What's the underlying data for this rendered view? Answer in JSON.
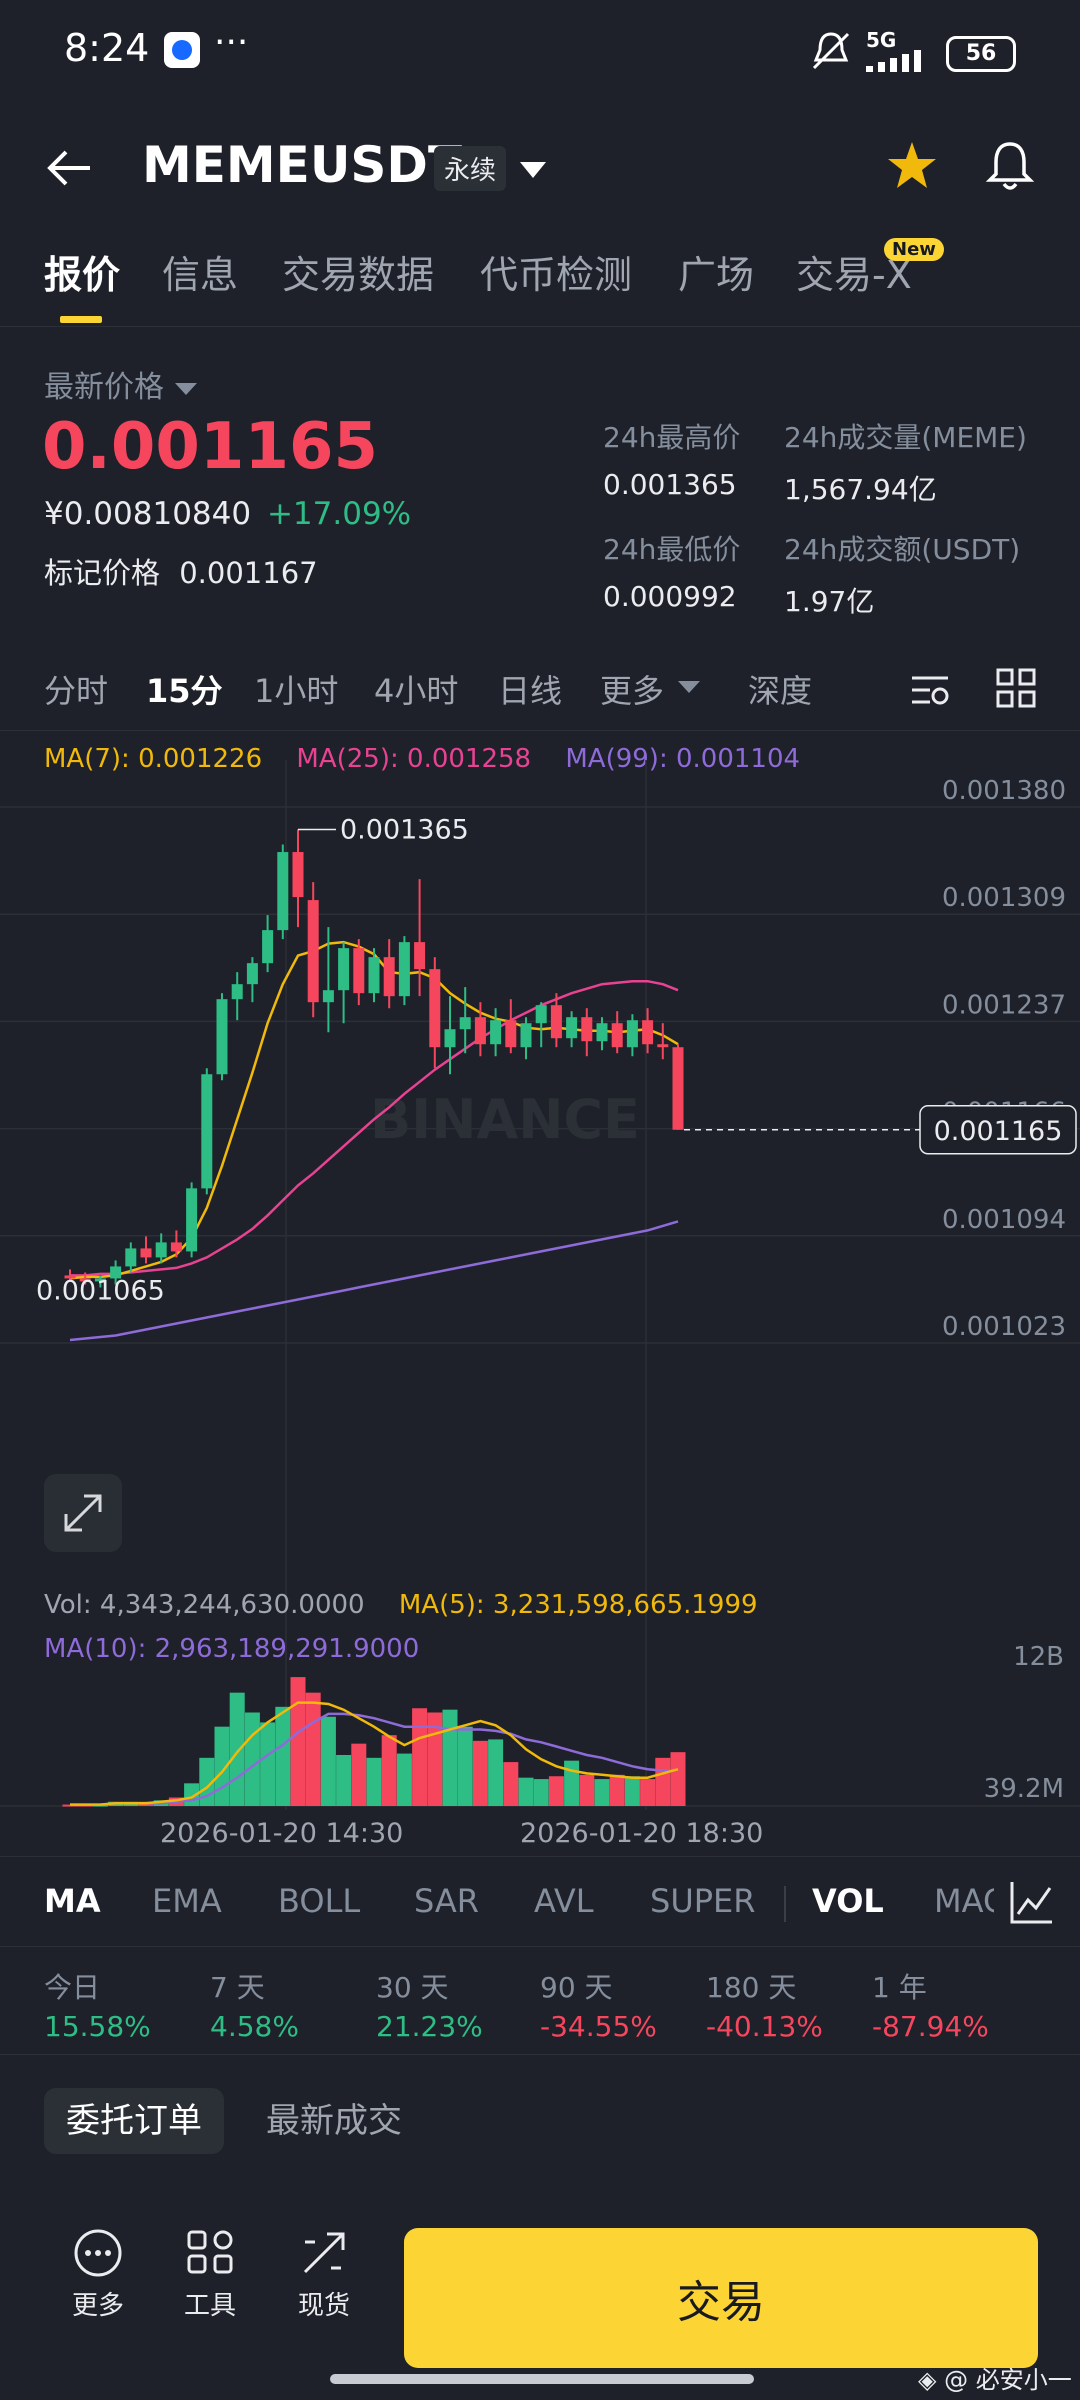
{
  "status_bar": {
    "time": "8:24",
    "more": "···",
    "network": "5G",
    "battery": "56"
  },
  "header": {
    "back_icon": "arrow-left-icon",
    "symbol": "MEMEUSDT",
    "contract_type": "永续",
    "star_icon": "star-icon",
    "bell_icon": "bell-icon"
  },
  "tabs": [
    {
      "label": "报价",
      "active": true
    },
    {
      "label": "信息"
    },
    {
      "label": "交易数据"
    },
    {
      "label": "代币检测"
    },
    {
      "label": "广场"
    },
    {
      "label": "交易-X",
      "badge": "New"
    }
  ],
  "price": {
    "label": "最新价格",
    "last": "0.001165",
    "cny": "¥0.00810840",
    "change": "+17.09%",
    "mark_label": "标记价格",
    "mark_value": "0.001167"
  },
  "stats": {
    "high_label": "24h最高价",
    "high": "0.001365",
    "low_label": "24h最低价",
    "low": "0.000992",
    "vol_label": "24h成交量(MEME)",
    "vol": "1,567.94亿",
    "amt_label": "24h成交额(USDT)",
    "amt": "1.97亿"
  },
  "timeframes": [
    "分时",
    "15分",
    "1小时",
    "4小时",
    "日线",
    "更多",
    "深度"
  ],
  "active_timeframe": "15分",
  "ma_legend": {
    "ma7": "MA(7): 0.001226",
    "ma25": "MA(25): 0.001258",
    "ma99": "MA(99): 0.001104"
  },
  "price_axis": [
    "0.001380",
    "0.001309",
    "0.001237",
    "0.001166",
    "0.001094",
    "0.001023"
  ],
  "current_price_tag": "0.001165",
  "chart_high_label": "0.001365",
  "chart_low_label": "0.001065",
  "watermark": "BINANCE",
  "volume": {
    "vol_text": "Vol: 4,343,244,630.0000",
    "ma5_text": "MA(5): 3,231,598,665.1999",
    "ma10_text": "MA(10): 2,963,189,291.9000",
    "axis_top": "12B",
    "axis_bottom": "39.2M"
  },
  "time_axis": [
    "2026-01-20 14:30",
    "2026-01-20 18:30"
  ],
  "indicators": [
    "MA",
    "EMA",
    "BOLL",
    "SAR",
    "AVL",
    "SUPER",
    "VOL",
    "MAC"
  ],
  "active_indicators": [
    "MA",
    "VOL"
  ],
  "performance": [
    {
      "label": "今日",
      "value": "15.58%",
      "dir": "up"
    },
    {
      "label": "7 天",
      "value": "4.58%",
      "dir": "up"
    },
    {
      "label": "30 天",
      "value": "21.23%",
      "dir": "up"
    },
    {
      "label": "90 天",
      "value": "-34.55%",
      "dir": "down"
    },
    {
      "label": "180 天",
      "value": "-40.13%",
      "dir": "down"
    },
    {
      "label": "1 年",
      "value": "-87.94%",
      "dir": "down"
    }
  ],
  "order_tabs": [
    "委托订单",
    "最新成交"
  ],
  "bottom": {
    "more": "更多",
    "tools": "工具",
    "spot": "现货",
    "trade": "交易"
  },
  "credit": "@ 必安小一",
  "colors": {
    "up": "#2ebd85",
    "down": "#f6465d",
    "accent": "#fcd535",
    "ma7": "#f0b90b",
    "ma25": "#e84393",
    "ma99": "#8e6bd8"
  },
  "chart_data": {
    "type": "candlestick",
    "ylim": [
      0.001023,
      0.00138
    ],
    "candles": [
      {
        "o": 0.001068,
        "h": 0.001072,
        "l": 0.001064,
        "c": 0.001066
      },
      {
        "o": 0.001066,
        "h": 0.00107,
        "l": 0.001062,
        "c": 0.001064
      },
      {
        "o": 0.001064,
        "h": 0.001068,
        "l": 0.00106,
        "c": 0.001066
      },
      {
        "o": 0.001066,
        "h": 0.001078,
        "l": 0.001062,
        "c": 0.001074
      },
      {
        "o": 0.001074,
        "h": 0.00109,
        "l": 0.00107,
        "c": 0.001086
      },
      {
        "o": 0.001086,
        "h": 0.001094,
        "l": 0.001076,
        "c": 0.00108
      },
      {
        "o": 0.00108,
        "h": 0.001096,
        "l": 0.001076,
        "c": 0.00109
      },
      {
        "o": 0.00109,
        "h": 0.001098,
        "l": 0.00108,
        "c": 0.001084
      },
      {
        "o": 0.001084,
        "h": 0.00113,
        "l": 0.00108,
        "c": 0.001126
      },
      {
        "o": 0.001126,
        "h": 0.001206,
        "l": 0.001122,
        "c": 0.001202
      },
      {
        "o": 0.001202,
        "h": 0.001256,
        "l": 0.001198,
        "c": 0.001252
      },
      {
        "o": 0.001252,
        "h": 0.00127,
        "l": 0.001238,
        "c": 0.001262
      },
      {
        "o": 0.001262,
        "h": 0.00128,
        "l": 0.00125,
        "c": 0.001276
      },
      {
        "o": 0.001276,
        "h": 0.001308,
        "l": 0.00127,
        "c": 0.001298
      },
      {
        "o": 0.001298,
        "h": 0.001355,
        "l": 0.001292,
        "c": 0.00135
      },
      {
        "o": 0.00135,
        "h": 0.001365,
        "l": 0.0013,
        "c": 0.00132
      },
      {
        "o": 0.001318,
        "h": 0.00133,
        "l": 0.00124,
        "c": 0.00125
      },
      {
        "o": 0.00125,
        "h": 0.0013,
        "l": 0.00123,
        "c": 0.001258
      },
      {
        "o": 0.001258,
        "h": 0.00129,
        "l": 0.001236,
        "c": 0.001286
      },
      {
        "o": 0.001286,
        "h": 0.001292,
        "l": 0.001248,
        "c": 0.001256
      },
      {
        "o": 0.001256,
        "h": 0.001286,
        "l": 0.00125,
        "c": 0.00128
      },
      {
        "o": 0.00128,
        "h": 0.001292,
        "l": 0.001246,
        "c": 0.001254
      },
      {
        "o": 0.001254,
        "h": 0.001294,
        "l": 0.001248,
        "c": 0.00129
      },
      {
        "o": 0.00129,
        "h": 0.001332,
        "l": 0.001254,
        "c": 0.001272
      },
      {
        "o": 0.001272,
        "h": 0.00128,
        "l": 0.001206,
        "c": 0.00122
      },
      {
        "o": 0.00122,
        "h": 0.001254,
        "l": 0.001202,
        "c": 0.001232
      },
      {
        "o": 0.001232,
        "h": 0.00126,
        "l": 0.001216,
        "c": 0.00124
      },
      {
        "o": 0.00124,
        "h": 0.00125,
        "l": 0.001214,
        "c": 0.001222
      },
      {
        "o": 0.001222,
        "h": 0.001246,
        "l": 0.001214,
        "c": 0.001238
      },
      {
        "o": 0.001238,
        "h": 0.001252,
        "l": 0.001216,
        "c": 0.00122
      },
      {
        "o": 0.00122,
        "h": 0.00124,
        "l": 0.001212,
        "c": 0.001236
      },
      {
        "o": 0.001236,
        "h": 0.00125,
        "l": 0.00122,
        "c": 0.001248
      },
      {
        "o": 0.001248,
        "h": 0.001256,
        "l": 0.00122,
        "c": 0.001226
      },
      {
        "o": 0.001226,
        "h": 0.001244,
        "l": 0.00122,
        "c": 0.00124
      },
      {
        "o": 0.00124,
        "h": 0.001246,
        "l": 0.001214,
        "c": 0.001224
      },
      {
        "o": 0.001224,
        "h": 0.00124,
        "l": 0.001218,
        "c": 0.001236
      },
      {
        "o": 0.001236,
        "h": 0.001244,
        "l": 0.001216,
        "c": 0.00122
      },
      {
        "o": 0.00122,
        "h": 0.001242,
        "l": 0.001214,
        "c": 0.001238
      },
      {
        "o": 0.001238,
        "h": 0.001246,
        "l": 0.001216,
        "c": 0.001222
      },
      {
        "o": 0.001222,
        "h": 0.001236,
        "l": 0.001212,
        "c": 0.00122
      },
      {
        "o": 0.00122,
        "h": 0.001222,
        "l": 0.001165,
        "c": 0.001165
      }
    ],
    "ma7": [
      0.001066,
      0.001067,
      0.001067,
      0.001068,
      0.001071,
      0.001074,
      0.001077,
      0.001082,
      0.001093,
      0.001113,
      0.001141,
      0.001172,
      0.001203,
      0.001236,
      0.001262,
      0.001281,
      0.001284,
      0.001289,
      0.00129,
      0.001287,
      0.001282,
      0.00127,
      0.001269,
      0.00127,
      0.001266,
      0.001256,
      0.001249,
      0.001243,
      0.001239,
      0.001237,
      0.001233,
      0.001232,
      0.001233,
      0.001232,
      0.001231,
      0.001231,
      0.00123,
      0.001231,
      0.001232,
      0.001228,
      0.001222
    ],
    "ma25": [
      0.001068,
      0.001068,
      0.001069,
      0.001069,
      0.00107,
      0.001071,
      0.001072,
      0.001073,
      0.001076,
      0.00108,
      0.001086,
      0.001092,
      0.001099,
      0.001108,
      0.001118,
      0.001128,
      0.001136,
      0.001145,
      0.001154,
      0.001163,
      0.001172,
      0.00118,
      0.001189,
      0.001197,
      0.001205,
      0.001212,
      0.001219,
      0.001226,
      0.001232,
      0.001238,
      0.001243,
      0.001248,
      0.001252,
      0.001256,
      0.001259,
      0.001262,
      0.001263,
      0.001264,
      0.001264,
      0.001262,
      0.001258
    ],
    "ma99": [
      0.001025,
      0.001026,
      0.001027,
      0.001028,
      0.00103,
      0.001032,
      0.001034,
      0.001036,
      0.001038,
      0.00104,
      0.001042,
      0.001044,
      0.001046,
      0.001048,
      0.00105,
      0.001052,
      0.001054,
      0.001056,
      0.001058,
      0.00106,
      0.001062,
      0.001064,
      0.001066,
      0.001068,
      0.00107,
      0.001072,
      0.001074,
      0.001076,
      0.001078,
      0.00108,
      0.001082,
      0.001084,
      0.001086,
      0.001088,
      0.00109,
      0.001092,
      0.001094,
      0.001096,
      0.001098,
      0.001101,
      0.001104
    ],
    "volumes": [
      0.1,
      0.1,
      0.1,
      0.3,
      0.3,
      0.3,
      0.4,
      0.6,
      1.6,
      3.4,
      5.6,
      8.0,
      6.6,
      5.9,
      7.0,
      9.1,
      8.0,
      6.3,
      3.6,
      4.4,
      3.4,
      5.0,
      3.7,
      6.9,
      6.6,
      6.8,
      5.6,
      4.6,
      4.7,
      3.1,
      2.0,
      1.9,
      2.1,
      3.2,
      2.2,
      1.9,
      2.2,
      2.1,
      1.9,
      3.4,
      3.8
    ],
    "vol_ma5": [
      0.1,
      0.1,
      0.1,
      0.2,
      0.2,
      0.2,
      0.3,
      0.4,
      0.6,
      1.3,
      2.4,
      3.8,
      5.0,
      5.9,
      6.6,
      7.3,
      7.3,
      7.2,
      6.8,
      6.2,
      5.6,
      4.9,
      4.3,
      4.8,
      5.1,
      5.4,
      5.7,
      6.0,
      5.7,
      5.0,
      4.0,
      3.3,
      2.8,
      2.5,
      2.3,
      2.2,
      2.1,
      2.0,
      2.0,
      2.3,
      2.6
    ],
    "vol_ma10": [
      0.1,
      0.1,
      0.1,
      0.2,
      0.2,
      0.2,
      0.2,
      0.3,
      0.4,
      0.7,
      1.3,
      2.0,
      2.8,
      3.6,
      4.3,
      5.2,
      5.9,
      6.5,
      6.5,
      6.4,
      6.2,
      5.9,
      5.6,
      5.6,
      5.6,
      5.4,
      5.4,
      5.4,
      5.3,
      5.1,
      4.7,
      4.5,
      4.2,
      3.9,
      3.6,
      3.4,
      3.1,
      2.8,
      2.6,
      2.5,
      2.5
    ],
    "vol_ylim": [
      0,
      12
    ]
  }
}
